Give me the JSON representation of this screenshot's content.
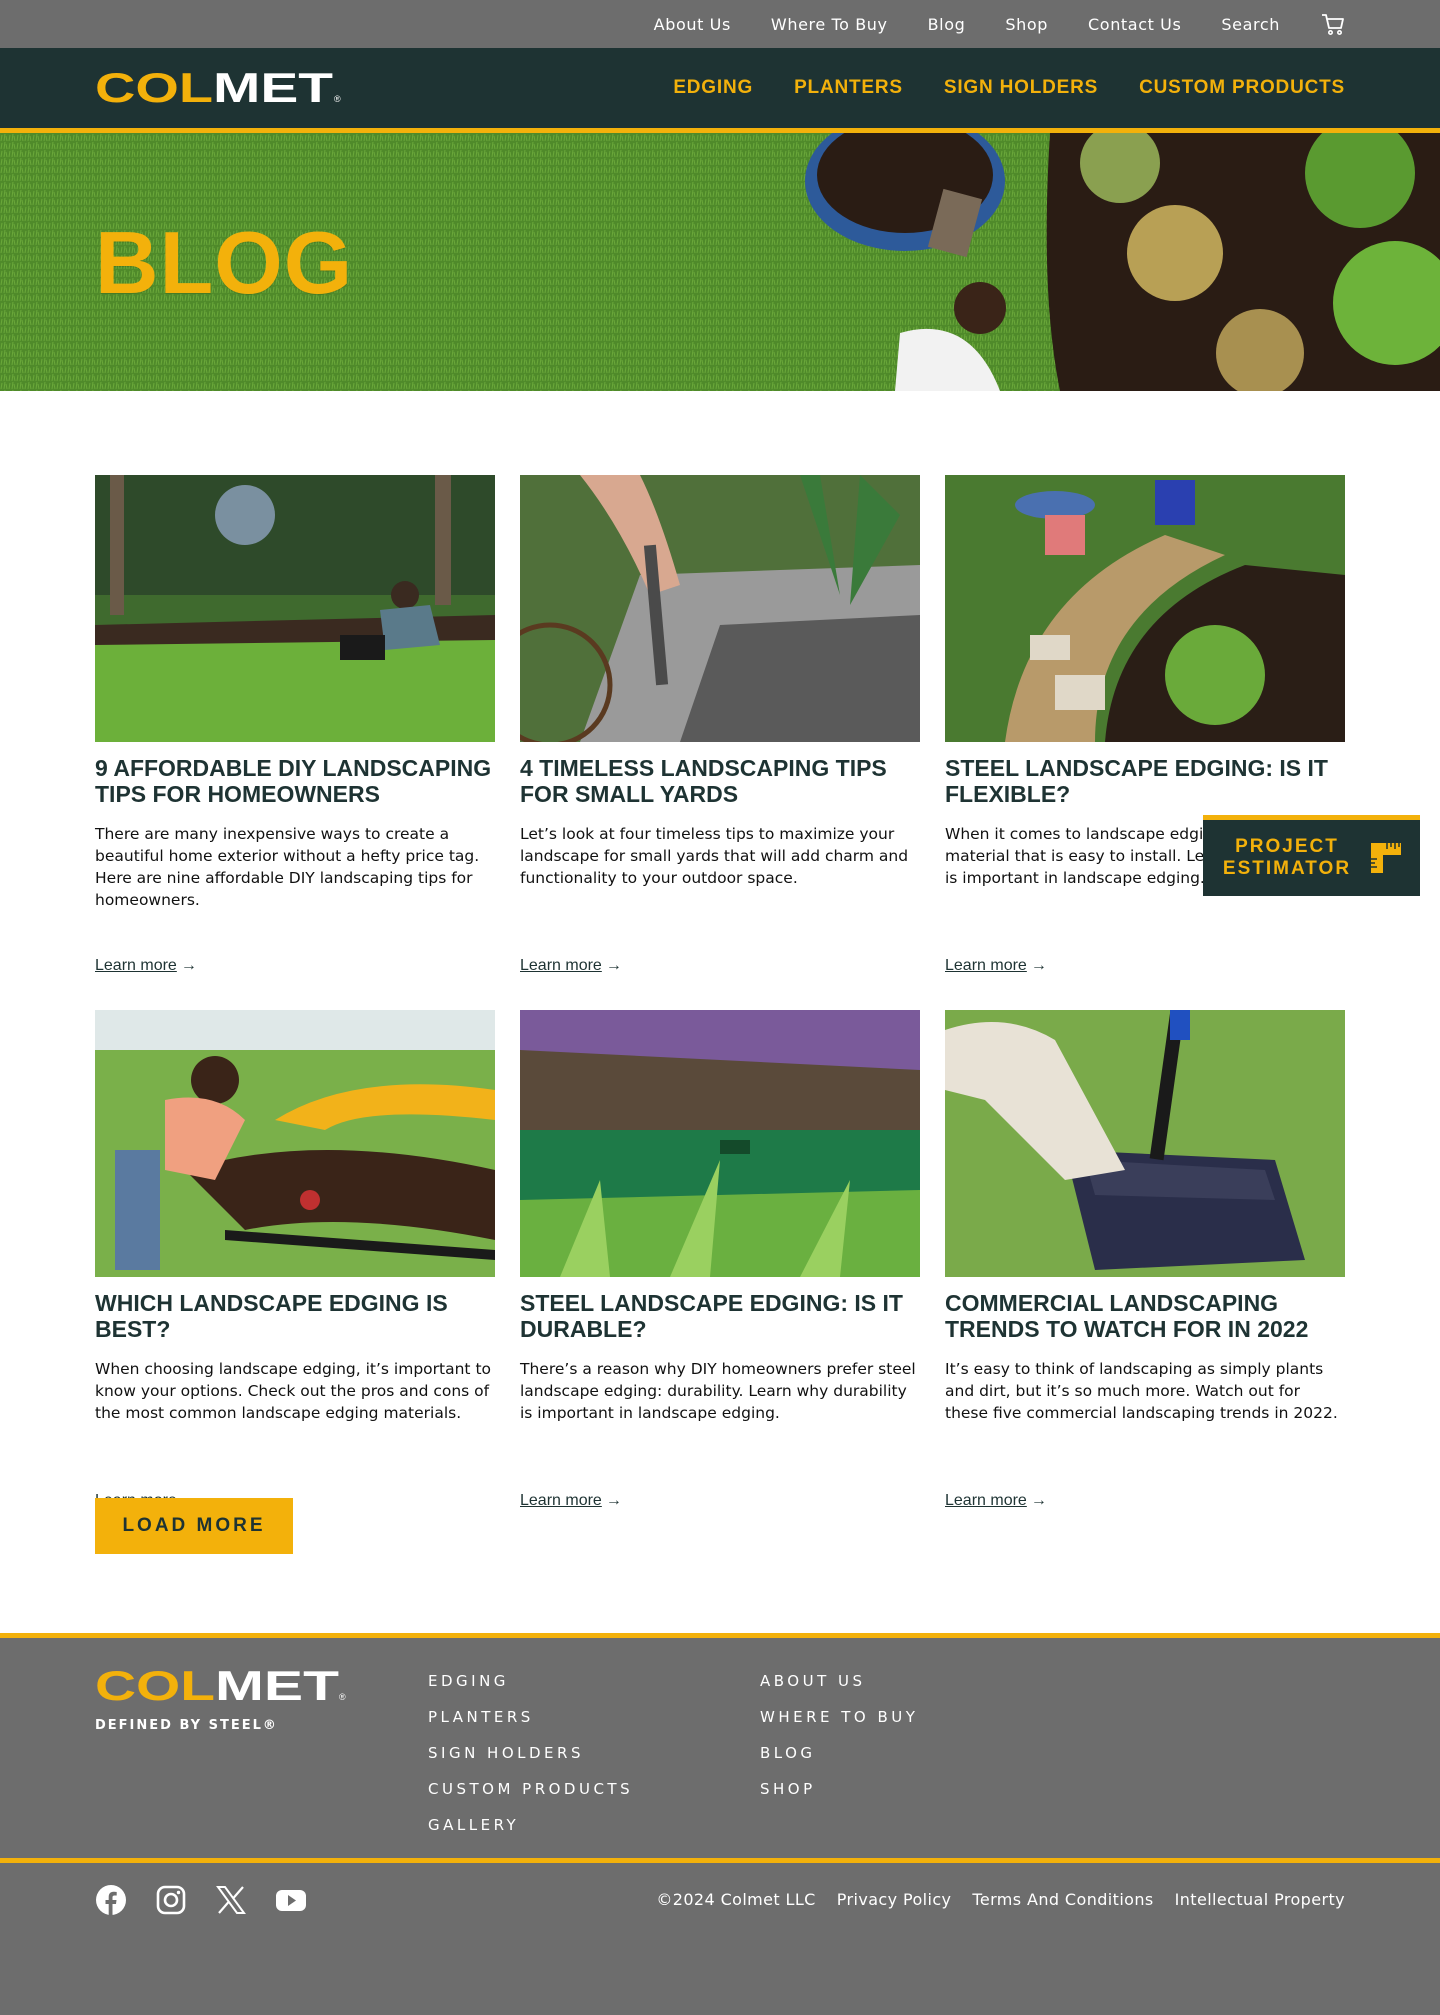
{
  "utility_nav": {
    "items": [
      "About Us",
      "Where To Buy",
      "Blog",
      "Shop",
      "Contact Us",
      "Search"
    ],
    "cart_icon": "cart-icon"
  },
  "brand": {
    "name": "COLMET",
    "tagline": "DEFINED BY STEEL®"
  },
  "main_nav": {
    "items": [
      "EDGING",
      "PLANTERS",
      "SIGN HOLDERS",
      "CUSTOM PRODUCTS"
    ]
  },
  "hero": {
    "title": "BLOG"
  },
  "posts": [
    {
      "title": "9 Affordable DIY Landscaping Tips for Homeowners",
      "excerpt": "There are many inexpensive ways to create a beautiful home exterior without a hefty price tag. Here are nine affordable DIY landscaping tips for homeowners.",
      "link": "Learn more"
    },
    {
      "title": "4 Timeless Landscaping Tips for Small Yards",
      "excerpt": "Let’s look at four timeless tips to maximize your landscape for small yards that will add charm and functionality to your outdoor space.",
      "link": "Learn more"
    },
    {
      "title": "Steel Landscape Edging: Is It Flexible?",
      "excerpt": "When it comes to landscape edging, you want a material that is easy to install. Learn why flexibility is important in landscape edging.",
      "link": "Learn more"
    },
    {
      "title": "Which Landscape Edging Is Best?",
      "excerpt": "When choosing landscape edging, it’s important to know your options. Check out the pros and cons of the most common landscape edging materials.",
      "link": "Learn more"
    },
    {
      "title": "Steel Landscape Edging: Is It Durable?",
      "excerpt": "There’s a reason why DIY homeowners prefer steel landscape edging: durability. Learn why durability is important in landscape edging.",
      "link": "Learn more"
    },
    {
      "title": "Commercial Landscaping Trends to Watch for in 2022",
      "excerpt": "It’s easy to think of landscaping as simply plants and dirt, but it’s so much more. Watch out for these five commercial landscaping trends in 2022.",
      "link": "Learn more"
    }
  ],
  "load_more": "LOAD MORE",
  "estimator": {
    "line1": "PROJECT",
    "line2": "ESTIMATOR",
    "icon": "ruler-icon"
  },
  "footer": {
    "col1": [
      "EDGING",
      "PLANTERS",
      "SIGN HOLDERS",
      "CUSTOM PRODUCTS",
      "GALLERY"
    ],
    "col2": [
      "ABOUT US",
      "WHERE TO BUY",
      "BLOG",
      "SHOP"
    ],
    "social_icons": [
      "facebook-icon",
      "instagram-icon",
      "x-icon",
      "youtube-icon"
    ],
    "legal": [
      "©2024 Colmet LLC",
      "Privacy Policy",
      "Terms And Conditions",
      "Intellectual Property"
    ]
  },
  "colors": {
    "accent": "#f3b10b",
    "dark": "#1e3333",
    "gray": "#6d6d6d"
  }
}
